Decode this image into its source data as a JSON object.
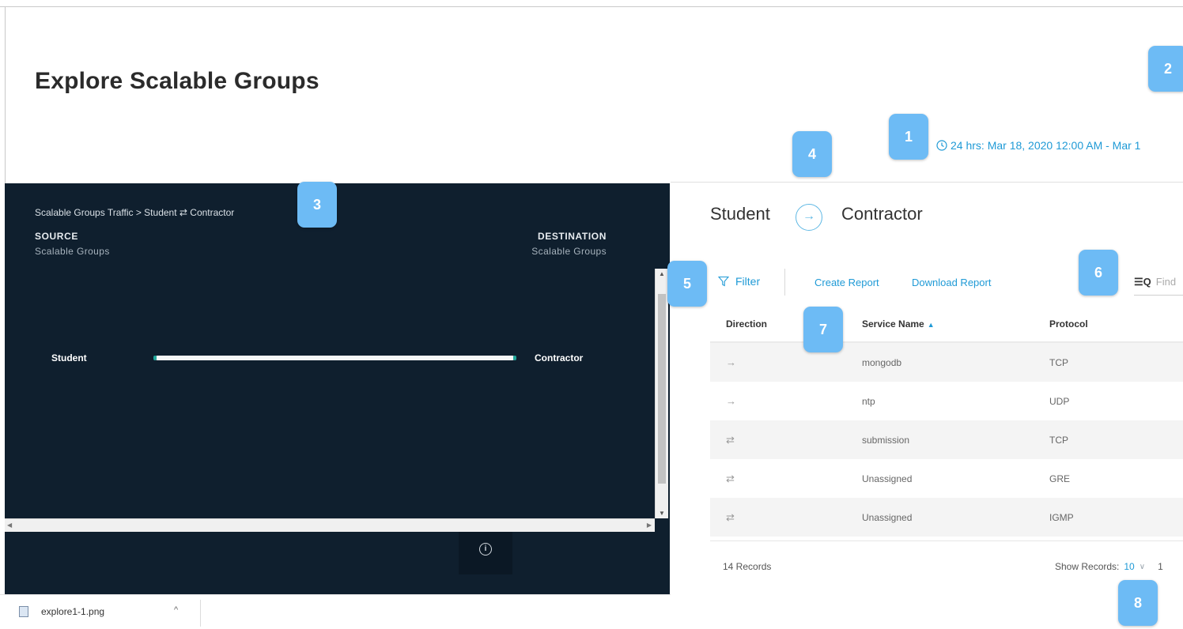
{
  "page": {
    "title": "Explore Scalable Groups",
    "time_range": "24 hrs:  Mar 18, 2020 12:00 AM - Mar 1"
  },
  "traffic_panel": {
    "breadcrumb": "Scalable Groups Traffic > Student ⇄ Contractor",
    "source_label": "SOURCE",
    "source_sub": "Scalable Groups",
    "destination_label": "DESTINATION",
    "destination_sub": "Scalable Groups",
    "left_node": "Student",
    "right_node": "Contractor",
    "info_glyph": "i"
  },
  "download_bar": {
    "file_name": "explore1-1.png",
    "chevron": "^"
  },
  "detail": {
    "source_group": "Student",
    "arrow_glyph": "→",
    "destination_group": "Contractor"
  },
  "toolbar": {
    "filter_label": "Filter",
    "create_report": "Create Report",
    "download_report": "Download Report",
    "find_placeholder": "Find",
    "find_icon_glyph": "☰Q"
  },
  "table": {
    "headers": [
      "Direction",
      "Service Name",
      "Protocol"
    ],
    "sort_glyph": "▲",
    "rows": [
      {
        "direction": "→",
        "service": "mongodb",
        "protocol": "TCP"
      },
      {
        "direction": "→",
        "service": "ntp",
        "protocol": "UDP"
      },
      {
        "direction": "⇄",
        "service": "submission",
        "protocol": "TCP"
      },
      {
        "direction": "⇄",
        "service": "Unassigned",
        "protocol": "GRE"
      },
      {
        "direction": "⇄",
        "service": "Unassigned",
        "protocol": "IGMP"
      }
    ]
  },
  "footer": {
    "records": "14 Records",
    "show_records_label": "Show Records:",
    "show_records_value": "10",
    "show_chevron": "∨",
    "page_number": "1"
  },
  "callouts": [
    "1",
    "2",
    "3",
    "4",
    "5",
    "6",
    "7",
    "8"
  ],
  "colors": {
    "accent": "#1f9ad6",
    "panel_bg": "#0f1f2e",
    "callout": "#6dbbf5"
  }
}
